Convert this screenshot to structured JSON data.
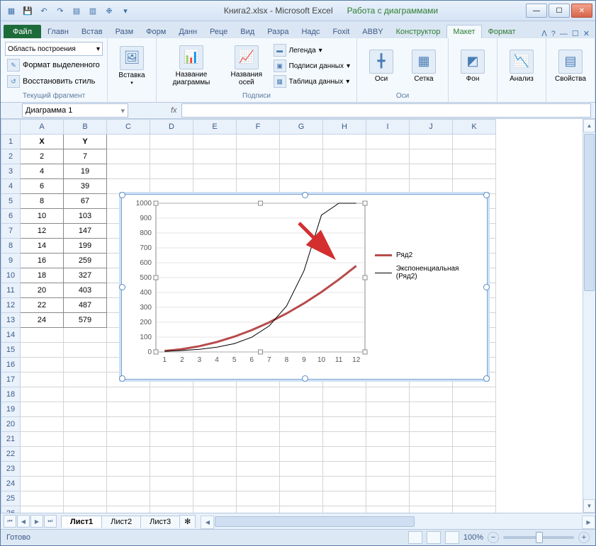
{
  "title": {
    "doc": "Книга2.xlsx - Microsoft Excel",
    "ctx": "Работа с диаграммами"
  },
  "tabs": {
    "file": "Файл",
    "items": [
      "Главн",
      "Встав",
      "Разм",
      "Форм",
      "Данн",
      "Реце",
      "Вид",
      "Разра",
      "Надс",
      "Foxit",
      "ABBY"
    ],
    "ctx": [
      "Конструктор",
      "Макет",
      "Формат"
    ],
    "active": "Макет"
  },
  "ribbon": {
    "sel_combo": "Область построения",
    "format_sel": "Формат выделенного",
    "reset_style": "Восстановить стиль",
    "g1": "Текущий фрагмент",
    "insert": "Вставка",
    "chart_name": "Название диаграммы",
    "axis_name": "Названия осей",
    "legend": "Легенда",
    "data_labels": "Подписи данных",
    "data_table": "Таблица данных",
    "g2": "Подписи",
    "axes": "Оси",
    "grid": "Сетка",
    "g3": "Оси",
    "bg": "Фон",
    "analysis": "Анализ",
    "props": "Свойства"
  },
  "namebox": "Диаграмма 1",
  "fx": "fx",
  "columns": [
    "A",
    "B",
    "C",
    "D",
    "E",
    "F",
    "G",
    "H",
    "I",
    "J",
    "K"
  ],
  "headers": {
    "x": "X",
    "y": "Y"
  },
  "rows": [
    {
      "x": 2,
      "y": 7
    },
    {
      "x": 4,
      "y": 19
    },
    {
      "x": 6,
      "y": 39
    },
    {
      "x": 8,
      "y": 67
    },
    {
      "x": 10,
      "y": 103
    },
    {
      "x": 12,
      "y": 147
    },
    {
      "x": 14,
      "y": 199
    },
    {
      "x": 16,
      "y": 259
    },
    {
      "x": 18,
      "y": 327
    },
    {
      "x": 20,
      "y": 403
    },
    {
      "x": 22,
      "y": 487
    },
    {
      "x": 24,
      "y": 579
    }
  ],
  "sheets": {
    "items": [
      "Лист1",
      "Лист2",
      "Лист3"
    ],
    "active": "Лист1"
  },
  "status": {
    "ready": "Готово",
    "zoom": "100%"
  },
  "chart_data": {
    "type": "line",
    "x": [
      1,
      2,
      3,
      4,
      5,
      6,
      7,
      8,
      9,
      10,
      11,
      12
    ],
    "series": [
      {
        "name": "Ряд2",
        "values": [
          7,
          19,
          39,
          67,
          103,
          147,
          199,
          259,
          327,
          403,
          487,
          579
        ],
        "color": "#b84b4b",
        "width": 3
      },
      {
        "name": "Экспоненциальная (Ряд2)",
        "values": [
          5,
          10,
          18,
          32,
          56,
          99,
          175,
          309,
          546,
          920,
          1000,
          1000
        ],
        "color": "#000",
        "width": 1
      }
    ],
    "ylim": [
      0,
      1000
    ],
    "ytick": 100,
    "legend": [
      "Ряд2",
      "Экспоненциальная (Ряд2)"
    ]
  }
}
